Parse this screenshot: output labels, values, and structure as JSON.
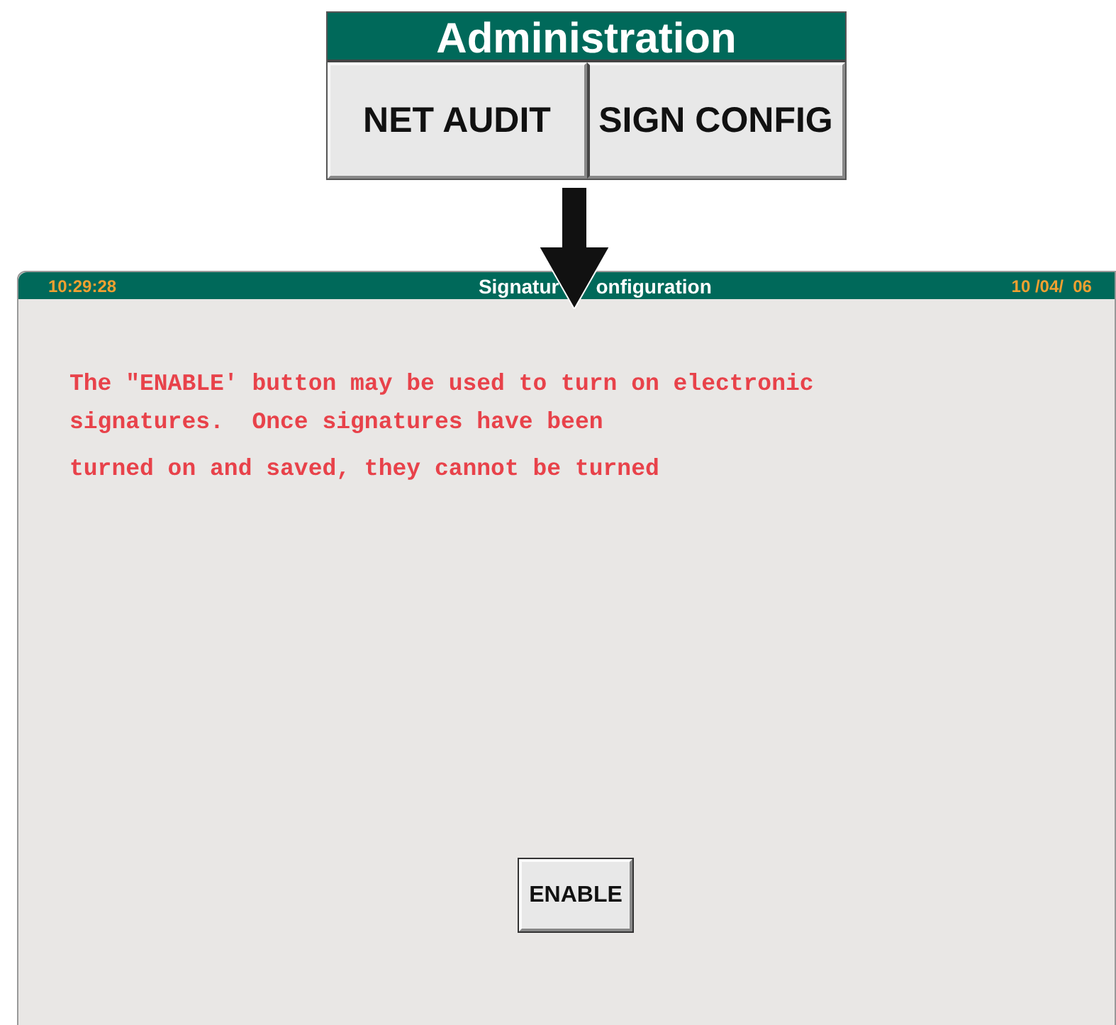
{
  "menu": {
    "title": "Administration",
    "buttons": [
      {
        "label": "NET AUDIT"
      },
      {
        "label": "SIGN CONFIG"
      }
    ]
  },
  "screen": {
    "time": "10:29:28",
    "title_parts": [
      "Signatur",
      "onfiguration"
    ],
    "date": "10 /04/  06",
    "message_lines": [
      "The \"ENABLE' button may be used to turn on electronic",
      "signatures.  Once signatures have been",
      "turned on and saved, they cannot be turned"
    ],
    "button": "ENABLE"
  }
}
